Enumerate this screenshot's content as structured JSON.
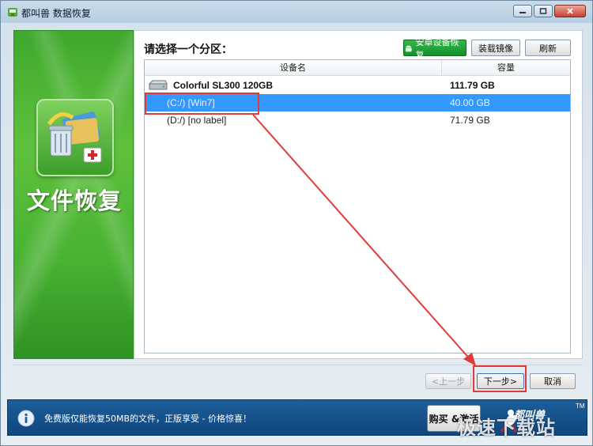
{
  "window": {
    "title": "都叫兽 数据恢复"
  },
  "sidebar": {
    "title": "文件恢复",
    "accent": "#48b232"
  },
  "main": {
    "prompt": "请选择一个分区：",
    "buttons": {
      "android": "安卓设备恢复",
      "mount": "装载镜像",
      "refresh": "刷新"
    },
    "table": {
      "headers": [
        "设备名",
        "容量"
      ],
      "disk": {
        "name": "Colorful SL300 120GB",
        "capacity": "111.79 GB"
      },
      "partitions": [
        {
          "name": "(C:/) [Win7]",
          "capacity": "40.00 GB",
          "selected": true
        },
        {
          "name": "(D:/) [no label]",
          "capacity": "71.79 GB",
          "selected": false
        }
      ]
    }
  },
  "nav": {
    "prev": "<上一步",
    "next": "下一步>",
    "cancel": "取消"
  },
  "status": {
    "notice": "免费版仅能恢复50MB的文件，正版享受 - 价格惊喜！",
    "buy": "购买 &激活",
    "brand": "都叫兽",
    "tm": "TM"
  },
  "watermark": "极速下载站",
  "colors": {
    "selection": "#3399ff",
    "annotation": "#e23a3a",
    "status_bg": "#1e5e99"
  }
}
